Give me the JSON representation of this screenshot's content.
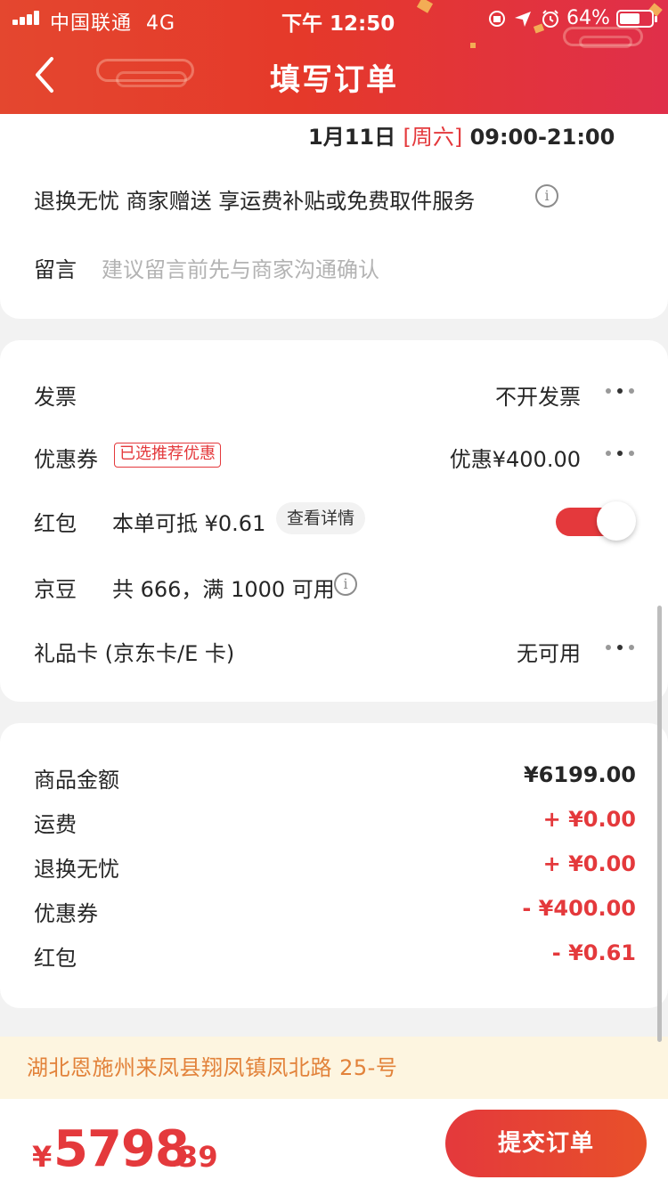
{
  "status_bar": {
    "carrier": "中国联通",
    "network": "4G",
    "time": "下午 12:50",
    "battery": "64%",
    "battery_level": 0.64
  },
  "header": {
    "title": "填写订单",
    "back_icon": "chevron-left-icon"
  },
  "delivery": {
    "date": "1月11日",
    "weekday": "[周六]",
    "time_range": "09:00-21:00"
  },
  "service": {
    "text": "退换无忧 商家赠送 享运费补贴或免费取件服务",
    "info_icon": "info-icon"
  },
  "message": {
    "label": "留言",
    "placeholder": "建议留言前先与商家沟通确认"
  },
  "options": {
    "invoice": {
      "label": "发票",
      "value": "不开发票"
    },
    "coupon": {
      "label": "优惠券",
      "tag": "已选推荐优惠",
      "value": "优惠¥400.00"
    },
    "red_packet": {
      "label": "红包",
      "desc": "本单可抵 ¥0.61",
      "detail_button": "查看详情",
      "enabled": true
    },
    "jingdou": {
      "label": "京豆",
      "desc": "共 666，满 1000 可用"
    },
    "gift_card": {
      "label": "礼品卡 (京东卡/E 卡)",
      "value": "无可用"
    }
  },
  "summary": [
    {
      "label": "商品金额",
      "value": "¥6199.00"
    },
    {
      "label": "运费",
      "value": "+ ¥0.00"
    },
    {
      "label": "退换无忧",
      "value": "+ ¥0.00"
    },
    {
      "label": "优惠券",
      "value": "- ¥400.00"
    },
    {
      "label": "红包",
      "value": "- ¥0.61"
    }
  ],
  "address": "湖北恩施州来凤县翔凤镇凤北路 25-号",
  "footer": {
    "currency": "¥",
    "total_int": "5798",
    "total_dec": ".39",
    "submit_label": "提交订单"
  },
  "colors": {
    "accent": "#e4393c",
    "address_text": "#e2823a",
    "address_bg": "#fdf5e0"
  }
}
